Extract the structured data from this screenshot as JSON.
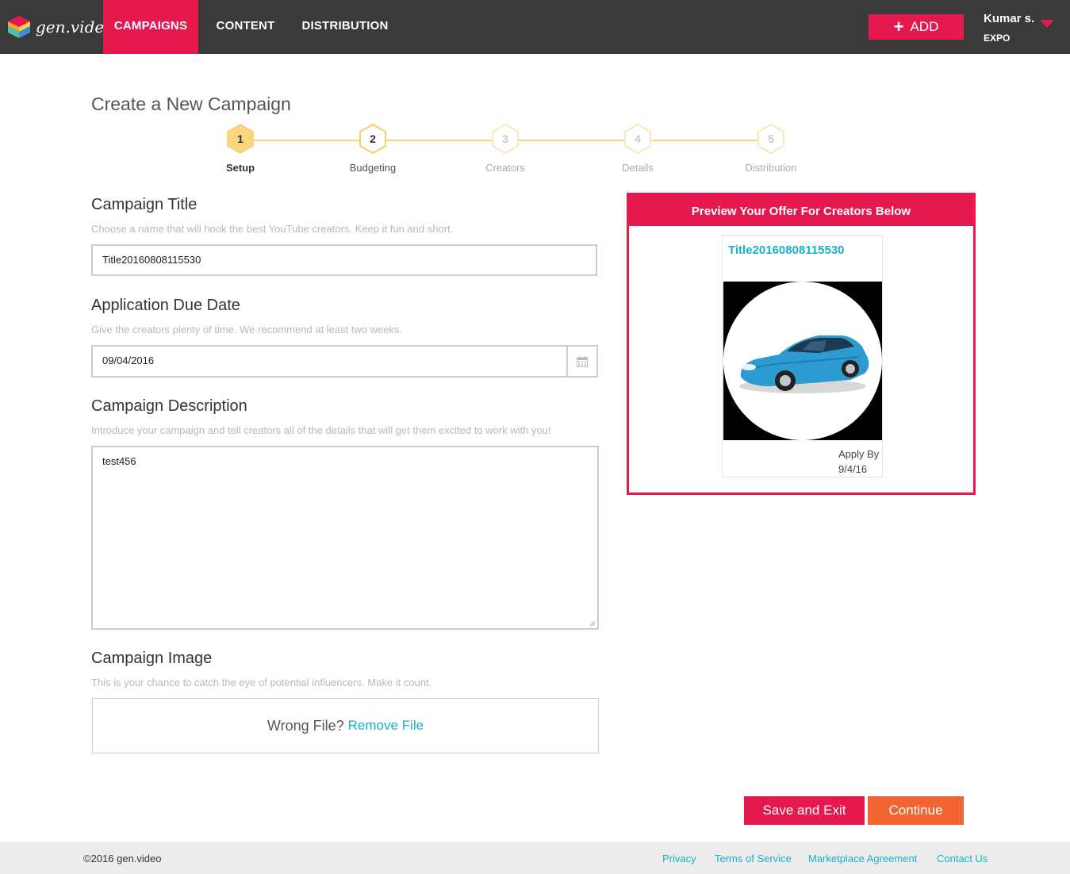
{
  "header": {
    "logo_text": "gen.video",
    "nav": [
      "CAMPAIGNS",
      "CONTENT",
      "DISTRIBUTION"
    ],
    "add_label": "ADD",
    "user_name": "Kumar s.",
    "user_org": "EXPO"
  },
  "page": {
    "title": "Create a New Campaign"
  },
  "stepper": {
    "current_step": 1,
    "steps": [
      {
        "number": "1",
        "label": "Setup"
      },
      {
        "number": "2",
        "label": "Budgeting"
      },
      {
        "number": "3",
        "label": "Creators"
      },
      {
        "number": "4",
        "label": "Details"
      },
      {
        "number": "5",
        "label": "Distribution"
      }
    ]
  },
  "form": {
    "title": {
      "label": "Campaign Title",
      "help": "Choose a name that will hook the best YouTube creators. Keep it fun and short.",
      "value": "Title20160808115530"
    },
    "due_date": {
      "label": "Application Due Date",
      "help": "Give the creators plenty of time. We recommend at least two weeks.",
      "value": "09/04/2016"
    },
    "description": {
      "label": "Campaign Description",
      "help": "Introduce your campaign and tell creators all of the details that will get them excited to work with you!",
      "value": "test456"
    },
    "image": {
      "label": "Campaign Image",
      "help": "This is your chance to catch the eye of potential influencers. Make it count.",
      "wrong_file_text": "Wrong File?",
      "remove_label": "Remove File"
    }
  },
  "preview": {
    "heading": "Preview Your Offer For Creators Below",
    "card_title": "Title20160808115530",
    "apply_by_label": "Apply By",
    "apply_by_date": "9/4/16"
  },
  "actions": {
    "save_exit": "Save and Exit",
    "continue": "Continue"
  },
  "footer": {
    "copyright": "©2016 gen.video",
    "links": [
      "Privacy",
      "Terms of Service",
      "Marketplace Agreement",
      "Contact Us"
    ]
  },
  "colors": {
    "brand": "#e6194f",
    "continue": "#f26533",
    "link": "#1ab0c6",
    "step_active": "#f5d77e",
    "topbar": "#3a3a3a"
  }
}
